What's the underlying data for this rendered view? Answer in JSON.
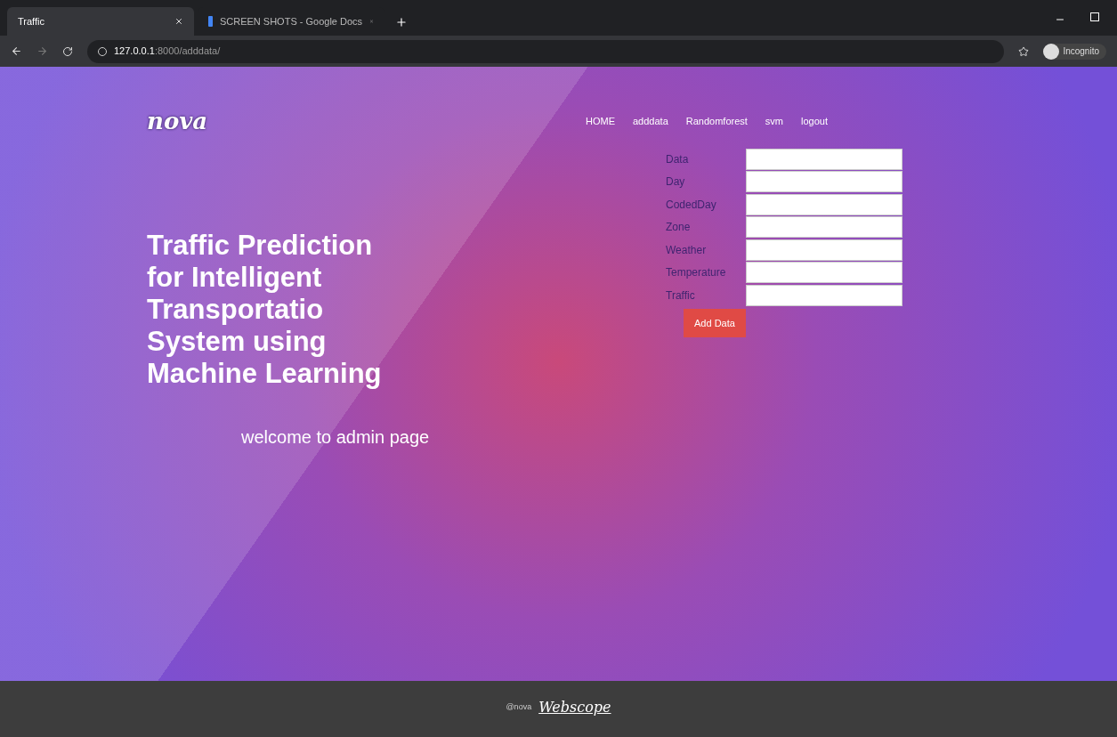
{
  "browser": {
    "tabs": [
      {
        "title": "Traffic",
        "selected": true
      },
      {
        "title": "SCREEN SHOTS - Google Docs",
        "selected": false
      }
    ],
    "url_host": "127.0.0.1",
    "url_path": ":8000/adddata/",
    "profile": "Incognito"
  },
  "site": {
    "logo": "nova",
    "nav": [
      "HOME",
      "adddata",
      "Randomforest",
      "svm",
      "logout"
    ],
    "heading": "Traffic Prediction for Intelligent Transportatio System using Machine Learning",
    "welcome": "welcome to admin page",
    "form": {
      "fields": [
        {
          "label": "Data"
        },
        {
          "label": "Day"
        },
        {
          "label": "CodedDay"
        },
        {
          "label": "Zone"
        },
        {
          "label": "Weather"
        },
        {
          "label": "Temperature"
        },
        {
          "label": "Traffic"
        }
      ],
      "submit": "Add Data"
    },
    "footer": {
      "copyright": "@nova",
      "brand": "Webscope"
    }
  }
}
